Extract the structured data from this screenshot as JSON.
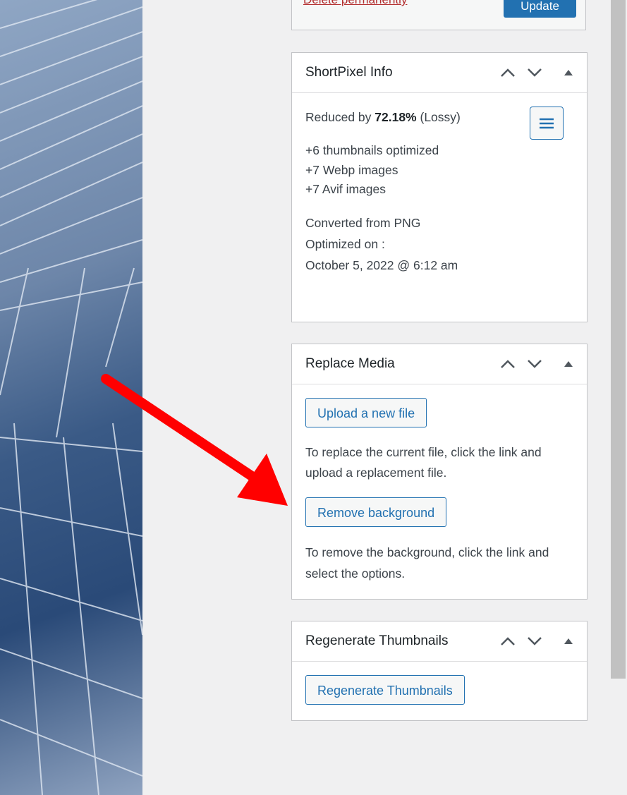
{
  "actions": {
    "delete_label": "Delete permanently",
    "update_label": "Update"
  },
  "shortpixel": {
    "title": "ShortPixel Info",
    "reduced_prefix": "Reduced by ",
    "reduced_value": "72.18%",
    "reduced_suffix": " (Lossy)",
    "thumbnails": "+6 thumbnails optimized",
    "webp": "+7 Webp images",
    "avif": "+7 Avif images",
    "converted": "Converted from PNG",
    "optimized_label": "Optimized on :",
    "optimized_date": "October 5, 2022 @ 6:12 am"
  },
  "replace_media": {
    "title": "Replace Media",
    "upload_button": "Upload a new file",
    "upload_desc": "To replace the current file, click the link and upload a replacement file.",
    "remove_bg_button": "Remove background",
    "remove_bg_desc": "To remove the background, click the link and select the options."
  },
  "regenerate": {
    "title": "Regenerate Thumbnails",
    "button": "Regenerate Thumbnails"
  },
  "icons": {
    "move_up": "chevron-up-icon",
    "move_down": "chevron-down-icon",
    "toggle": "triangle-up-icon",
    "menu": "hamburger-icon",
    "annotation": "red-arrow"
  },
  "colors": {
    "accent": "#2271b1",
    "delete": "#b32d2e",
    "annotation_arrow": "#ff0000"
  }
}
